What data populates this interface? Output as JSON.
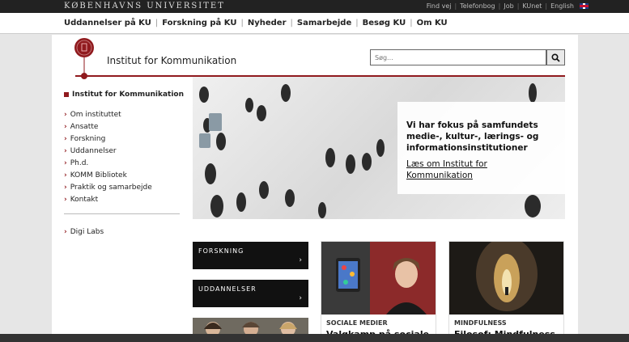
{
  "topbar": {
    "university": "KØBENHAVNS UNIVERSITET",
    "links": [
      "Find vej",
      "Telefonbog",
      "Job",
      "KUnet",
      "English"
    ]
  },
  "mainnav": {
    "items": [
      "Uddannelser på KU",
      "Forskning på KU",
      "Nyheder",
      "Samarbejde",
      "Besøg KU",
      "Om KU"
    ]
  },
  "header": {
    "institute": "Institut for Kommunikation"
  },
  "search": {
    "placeholder": "Søg..."
  },
  "sidebar": {
    "heading": "Institut for Kommunikation",
    "items": [
      "Om instituttet",
      "Ansatte",
      "Forskning",
      "Uddannelser",
      "Ph.d.",
      "KOMM Bibliotek",
      "Praktik og samarbejde",
      "Kontakt"
    ],
    "extra": "Digi Labs"
  },
  "hero": {
    "heading": "Vi har fokus på samfundets medie-, kultur-, lærings- og informationsinstitutioner",
    "link": "Læs om Institut for Kommunikation"
  },
  "tiles": {
    "research": "FORSKNING",
    "education": "UDDANNELSER",
    "arrow": "›"
  },
  "news": [
    {
      "tag": "SOCIALE MEDIER",
      "title": "Valgkamp på sociale"
    },
    {
      "tag": "MINDFULNESS",
      "title": "Filosof: Mindfulness"
    }
  ],
  "colors": {
    "accent": "#901a1e",
    "topbar": "#222222"
  }
}
